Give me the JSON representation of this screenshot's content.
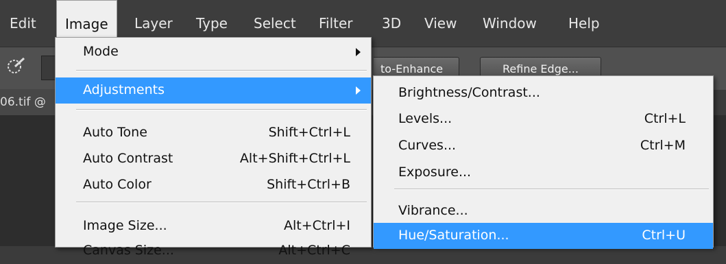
{
  "menubar": {
    "items": [
      {
        "label": "Edit"
      },
      {
        "label": "Image"
      },
      {
        "label": "Layer"
      },
      {
        "label": "Type"
      },
      {
        "label": "Select"
      },
      {
        "label": "Filter"
      },
      {
        "label": "3D"
      },
      {
        "label": "View"
      },
      {
        "label": "Window"
      },
      {
        "label": "Help"
      }
    ],
    "active": "Image"
  },
  "options_bar": {
    "auto_enhance_label": "to-Enhance",
    "refine_edge_label": "Refine Edge..."
  },
  "document_tab": {
    "title": "06.tif @"
  },
  "image_menu": {
    "items": [
      {
        "label": "Mode",
        "shortcut": "",
        "submenu": true
      },
      {
        "label": "Adjustments",
        "shortcut": "",
        "submenu": true,
        "highlighted": true
      },
      {
        "label": "Auto Tone",
        "shortcut": "Shift+Ctrl+L"
      },
      {
        "label": "Auto Contrast",
        "shortcut": "Alt+Shift+Ctrl+L"
      },
      {
        "label": "Auto Color",
        "shortcut": "Shift+Ctrl+B"
      },
      {
        "label": "Image Size...",
        "shortcut": "Alt+Ctrl+I"
      },
      {
        "label": "Canvas Size...",
        "shortcut": "Alt+Ctrl+C"
      }
    ]
  },
  "adjustments_submenu": {
    "items": [
      {
        "label": "Brightness/Contrast...",
        "shortcut": ""
      },
      {
        "label": "Levels...",
        "shortcut": "Ctrl+L"
      },
      {
        "label": "Curves...",
        "shortcut": "Ctrl+M"
      },
      {
        "label": "Exposure...",
        "shortcut": ""
      },
      {
        "label": "Vibrance...",
        "shortcut": ""
      },
      {
        "label": "Hue/Saturation...",
        "shortcut": "Ctrl+U",
        "highlighted": true
      }
    ]
  },
  "colors": {
    "highlight": "#3399ff",
    "menu_bg": "#f0f0f0",
    "menubar_bg": "#3d3d3d"
  }
}
